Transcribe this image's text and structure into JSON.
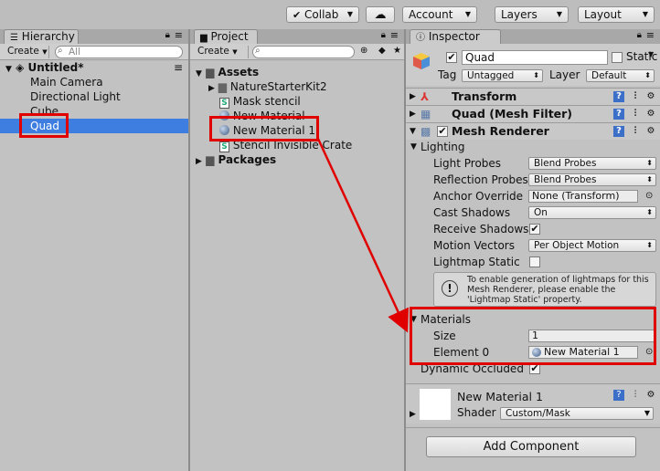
{
  "toolbar": {
    "collab": "Collab",
    "account": "Account",
    "layers": "Layers",
    "layout": "Layout"
  },
  "hierarchy": {
    "tab": "Hierarchy",
    "create": "Create",
    "search_placeholder": "All",
    "scene": "Untitled*",
    "items": [
      "Main Camera",
      "Directional Light",
      "Cube",
      "Quad"
    ]
  },
  "project": {
    "tab": "Project",
    "create": "Create",
    "assets": "Assets",
    "items": [
      "NatureStarterKit2",
      "Mask stencil",
      "New Material",
      "New Material 1",
      "Stencil Invisible Crate"
    ],
    "packages": "Packages"
  },
  "inspector": {
    "tab": "Inspector",
    "object_name": "Quad",
    "static_label": "Static",
    "tag_label": "Tag",
    "tag_value": "Untagged",
    "layer_label": "Layer",
    "layer_value": "Default",
    "components": {
      "transform": "Transform",
      "mesh_filter": "Quad (Mesh Filter)",
      "mesh_renderer": "Mesh Renderer"
    },
    "lighting": "Lighting",
    "props": {
      "light_probes": "Light Probes",
      "light_probes_value": "Blend Probes",
      "reflection_probes": "Reflection Probes",
      "reflection_probes_value": "Blend Probes",
      "anchor_override": "Anchor Override",
      "anchor_override_value": "None (Transform)",
      "cast_shadows": "Cast Shadows",
      "cast_shadows_value": "On",
      "receive_shadows": "Receive Shadows",
      "motion_vectors": "Motion Vectors",
      "motion_vectors_value": "Per Object Motion",
      "lightmap_static": "Lightmap Static"
    },
    "info_message": "To enable generation of lightmaps for this Mesh Renderer, please enable the 'Lightmap Static' property.",
    "materials": "Materials",
    "size_label": "Size",
    "size_value": "1",
    "element0_label": "Element 0",
    "element0_value": "New Material 1",
    "dynamic_occluded": "Dynamic Occluded",
    "material_name": "New Material 1",
    "shader_label": "Shader",
    "shader_value": "Custom/Mask",
    "add_component": "Add Component"
  },
  "colors": {
    "highlight_red": "#e00000",
    "selection_blue": "#3d7ee0"
  }
}
